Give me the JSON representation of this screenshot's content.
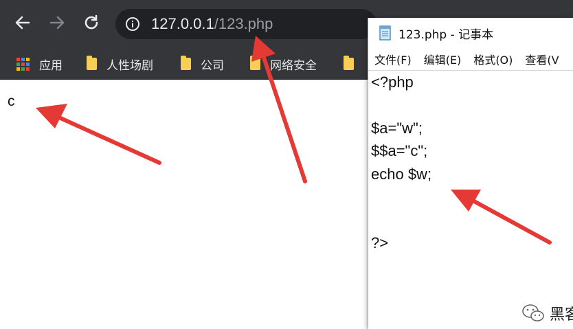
{
  "browser": {
    "url_host": "127.0.0.1",
    "url_path": "/123.php",
    "bookmarks": [
      {
        "label": "应用",
        "icon": "apps-grid-icon"
      },
      {
        "label": "人性场剧",
        "icon": "folder-icon"
      },
      {
        "label": "公司",
        "icon": "folder-icon"
      },
      {
        "label": "网络安全",
        "icon": "folder-icon"
      }
    ]
  },
  "page": {
    "output": "c"
  },
  "notepad": {
    "title": "123.php - 记事本",
    "menu": [
      "文件(F)",
      "编辑(E)",
      "格式(O)",
      "查看(V"
    ],
    "code_lines": [
      "<?php",
      "",
      "$a=\"w\";",
      "$$a=\"c\";",
      "echo $w;",
      "",
      "",
      "?>"
    ]
  },
  "watermark": {
    "text": "黑客"
  },
  "colors": {
    "chrome_bg": "#35363a",
    "omnibox_bg": "#202124",
    "arrow_red": "#e53935"
  }
}
